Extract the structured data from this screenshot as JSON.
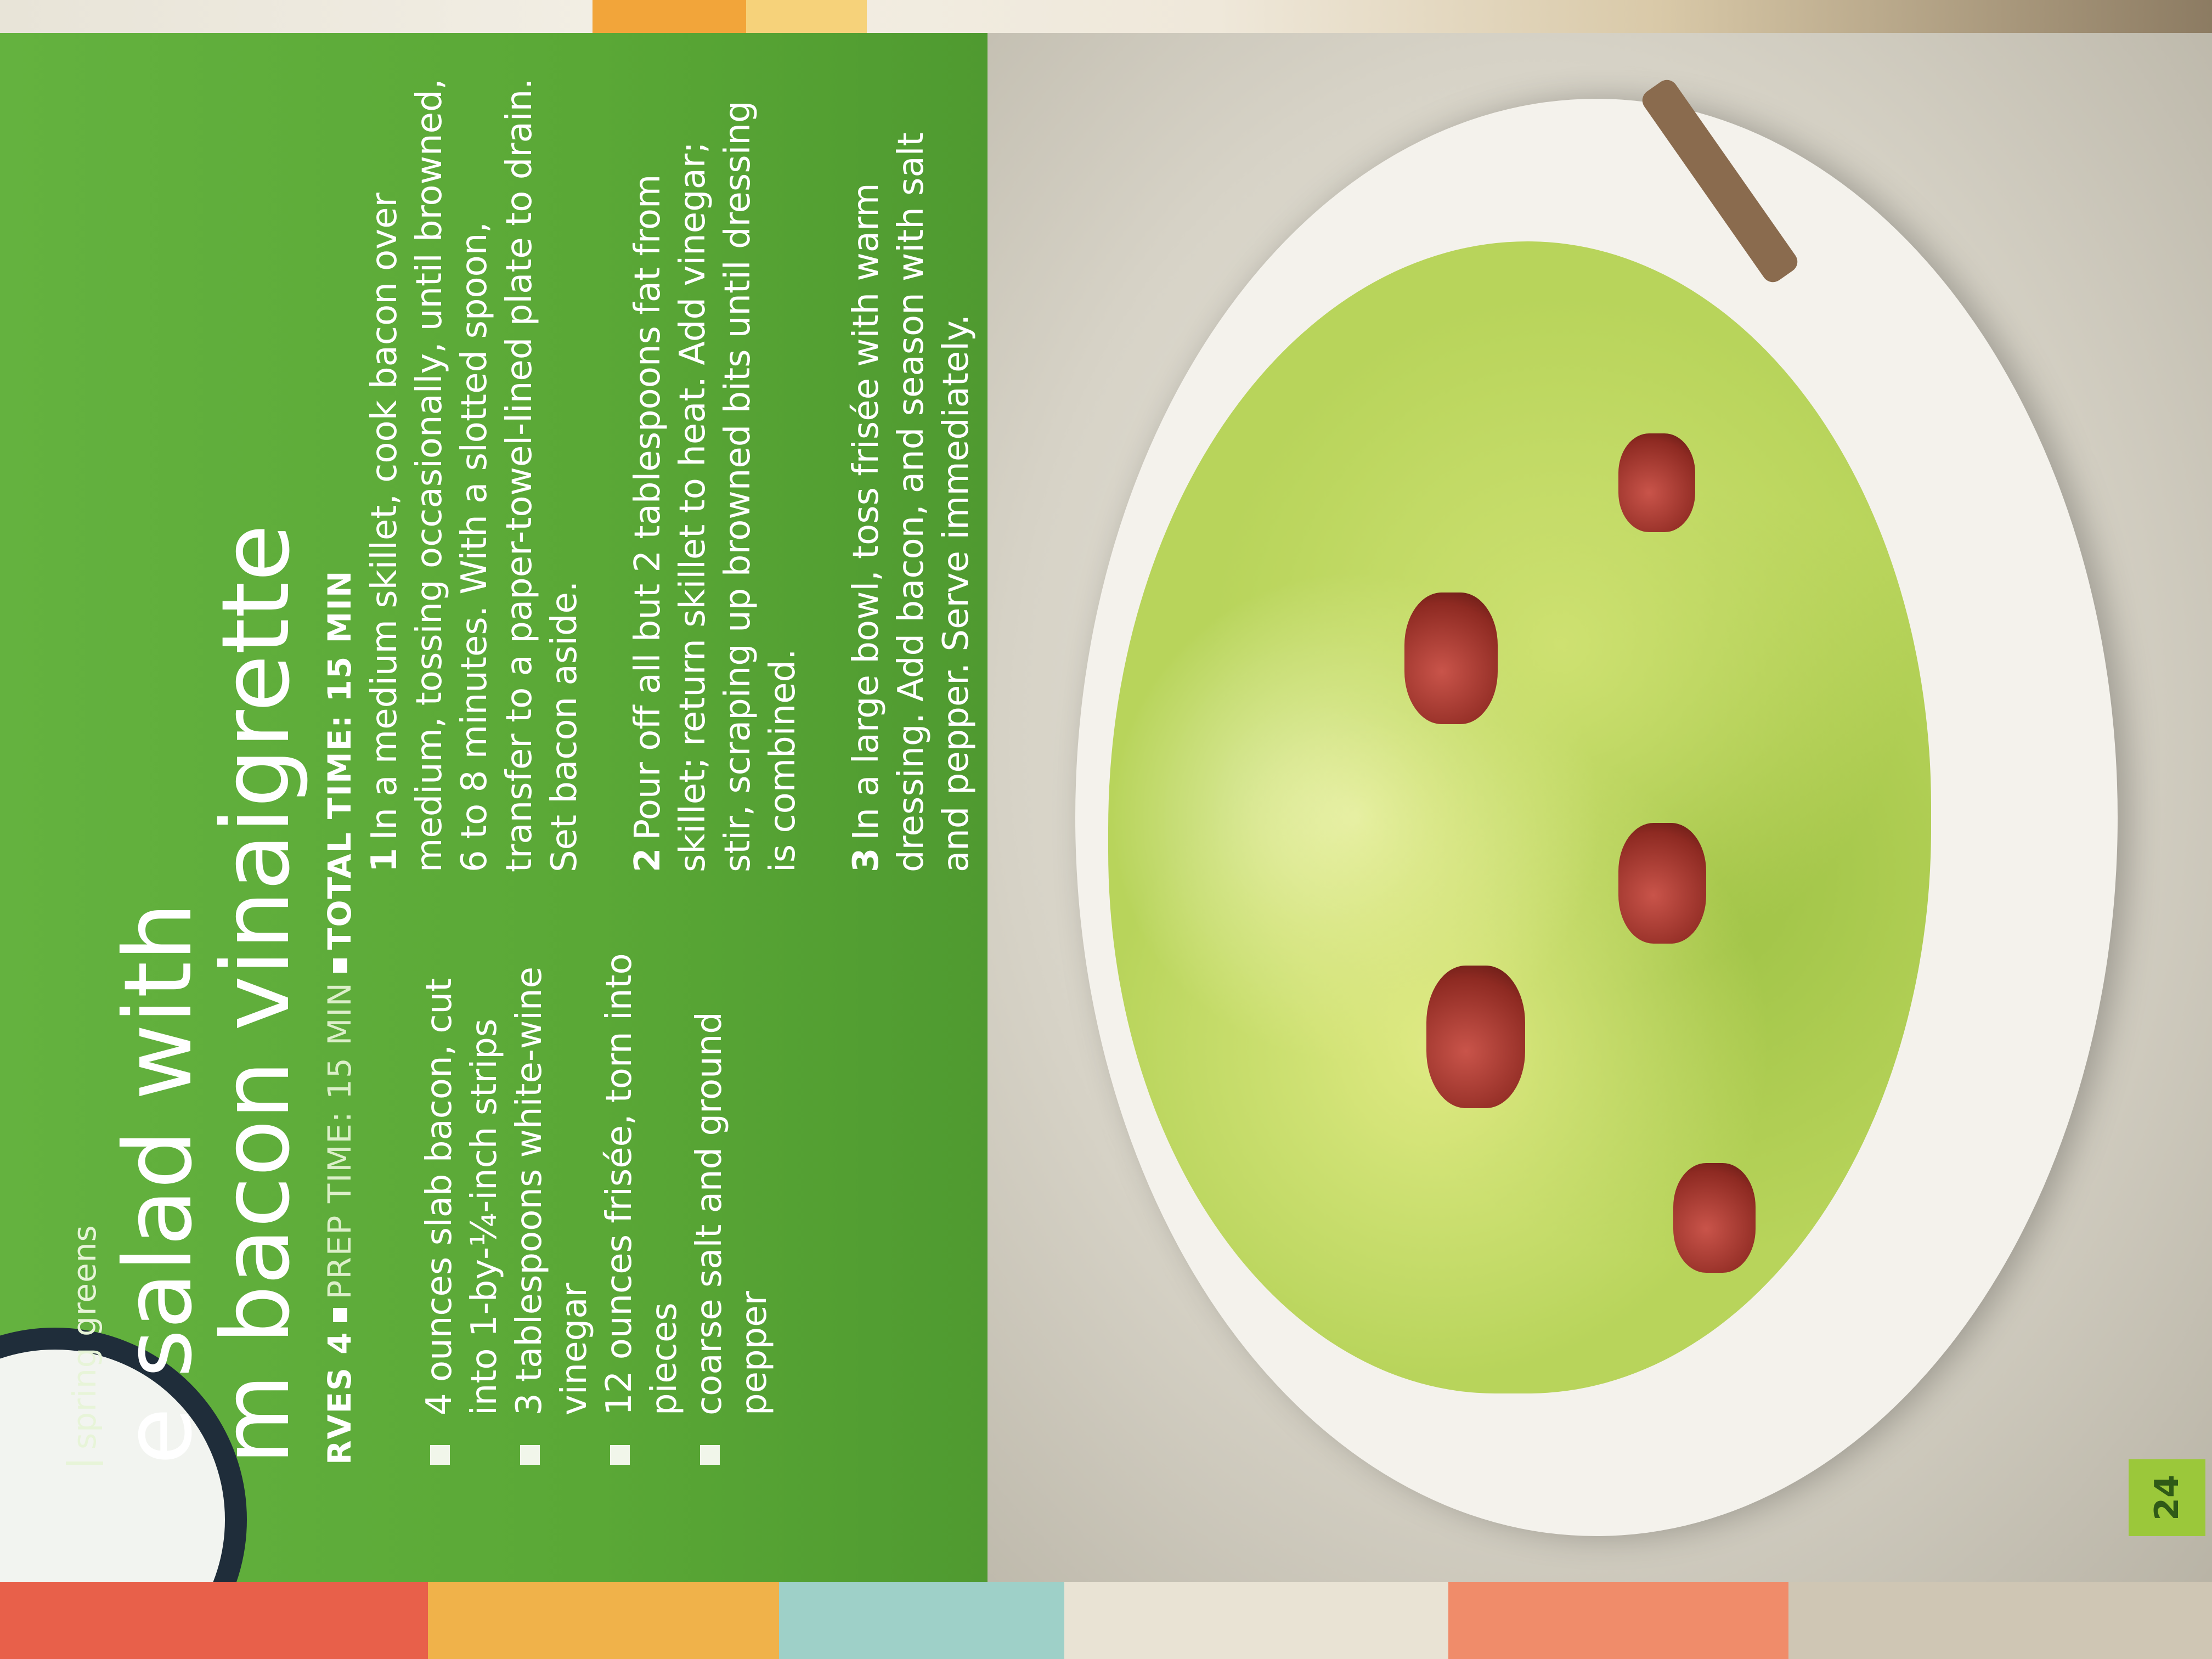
{
  "section_label": "spring greens",
  "title_line1": "e salad with",
  "title_line2": "m bacon vinaigrette",
  "meta": {
    "serves": "RVES 4",
    "prep": "PREP TIME: 15 MIN",
    "total": "TOTAL TIME: 15 MIN"
  },
  "ingredients": [
    "4 ounces slab bacon, cut into 1-by-¼-inch strips",
    "3 tablespoons white-wine vinegar",
    "12 ounces frisée, torn into pieces",
    "coarse salt and ground pepper"
  ],
  "steps": [
    {
      "num": "1",
      "text": "In a medium skillet, cook bacon over medium, tossing occasionally, until browned, 6 to 8 minutes. With a slotted spoon, transfer to a paper-towel-lined plate to drain. Set bacon aside."
    },
    {
      "num": "2",
      "text": "Pour off all but 2 tablespoons fat from skillet; return skillet to heat. Add vinegar; stir, scraping up browned bits until dressing is combined."
    },
    {
      "num": "3",
      "text": "In a large bowl, toss frisée with warm dressing. Add bacon, and season with salt and pepper. Serve immediately."
    }
  ],
  "page_number": "24",
  "colors": {
    "panel_green": "#5ca83a",
    "page_badge": "#9bc83a"
  }
}
